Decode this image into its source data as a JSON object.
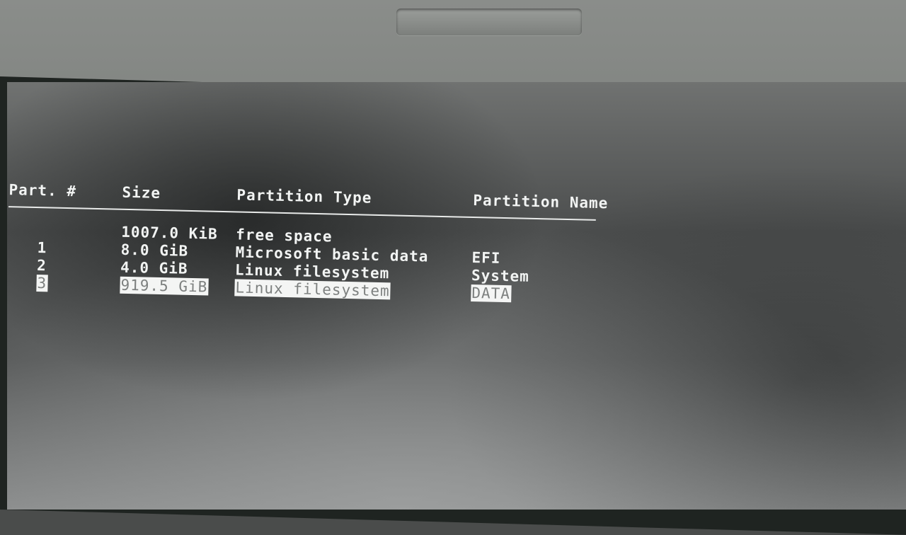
{
  "partition_table": {
    "columns": {
      "part": "Part. #",
      "size": "Size",
      "type": "Partition Type",
      "name": "Partition Name"
    },
    "rows": [
      {
        "part": "",
        "size": "1007.0 KiB",
        "type": "free space",
        "name": ""
      },
      {
        "part": "1",
        "size": "8.0 GiB",
        "type": "Microsoft basic data",
        "name": "EFI"
      },
      {
        "part": "2",
        "size": "4.0 GiB",
        "type": "Linux filesystem",
        "name": "System"
      },
      {
        "part": "3",
        "size": "919.5 GiB",
        "type": "Linux filesystem",
        "name": "DATA"
      }
    ],
    "selected_row": 3
  }
}
